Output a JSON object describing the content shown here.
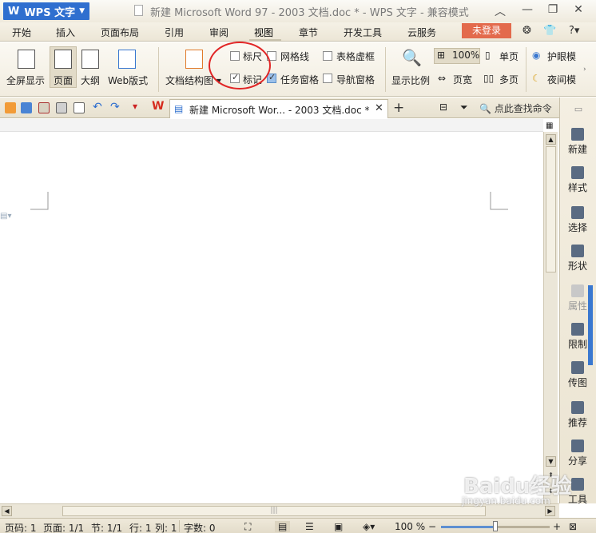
{
  "app": {
    "name": "WPS 文字",
    "window_title": "新建 Microsoft Word 97 - 2003 文档.doc * - WPS 文字 - 兼容模式"
  },
  "menu": {
    "tabs": [
      "开始",
      "插入",
      "页面布局",
      "引用",
      "审阅",
      "视图",
      "章节",
      "开发工具",
      "云服务"
    ],
    "active": "视图",
    "login": "未登录",
    "help": "?"
  },
  "ribbon": {
    "fullscreen": "全屏显示",
    "page": "页面",
    "outline": "大纲",
    "web": "Web版式",
    "doc_structure": "文档结构图",
    "ruler": "标尺",
    "gridlines": "网格线",
    "table_gridlines": "表格虚框",
    "marks": "标记",
    "task_pane": "任务窗格",
    "nav_pane": "导航窗格",
    "zoom_ratio": "显示比例",
    "zoom_100": "100%",
    "single_page": "单页",
    "page_width": "页宽",
    "multi_page": "多页",
    "eye_mode": "护眼模",
    "night_mode": "夜间模"
  },
  "checkboxes": {
    "ruler": false,
    "gridlines": false,
    "table_gridlines": false,
    "marks": true,
    "task_pane": true,
    "nav_pane": false
  },
  "doc_tab": {
    "label": "新建 Microsoft Wor... - 2003 文档.doc *",
    "close": "✕",
    "new": "+"
  },
  "search_cmd": "点此查找命令",
  "right_panel": [
    {
      "label": "新建",
      "icon": "new-doc-icon",
      "dim": false
    },
    {
      "label": "样式",
      "icon": "style-icon",
      "dim": false
    },
    {
      "label": "选择",
      "icon": "select-icon",
      "dim": false
    },
    {
      "label": "形状",
      "icon": "shape-icon",
      "dim": false
    },
    {
      "label": "属性",
      "icon": "property-icon",
      "dim": true
    },
    {
      "label": "限制",
      "icon": "restrict-icon",
      "dim": false
    },
    {
      "label": "传图",
      "icon": "image-upload-icon",
      "dim": false
    },
    {
      "label": "推荐",
      "icon": "recommend-icon",
      "dim": false
    },
    {
      "label": "分享",
      "icon": "share-icon",
      "dim": false
    },
    {
      "label": "工具",
      "icon": "toolbox-icon",
      "dim": false
    }
  ],
  "status": {
    "page_num": "页码: 1",
    "pages": "页面: 1/1",
    "section": "节: 1/1",
    "row": "行: 1",
    "col": "列: 1",
    "word_count": "字数: 0",
    "zoom": "100 %",
    "zoom_level": 0.5
  },
  "watermark": {
    "main": "Baidu经验",
    "sub": "jingyan.baidu.com"
  },
  "colors": {
    "wps_blue": "#2f6fcf",
    "login_red": "#e36a4c",
    "annotation_red": "#e12626"
  }
}
